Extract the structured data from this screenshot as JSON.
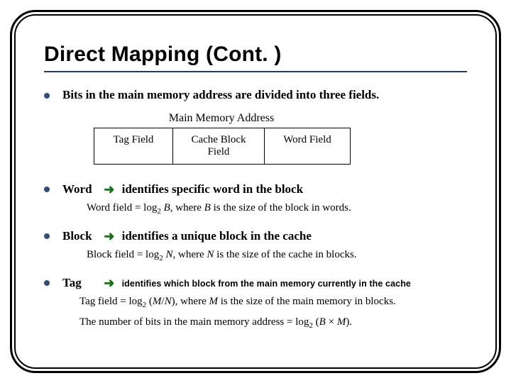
{
  "title": "Direct Mapping (Cont. )",
  "bullets": {
    "intro": "Bits in the main memory address are divided into three fields.",
    "word": {
      "term": "Word",
      "desc": "identifies specific word in the block"
    },
    "block": {
      "term": "Block",
      "desc": "identifies a unique block in the cache"
    },
    "tag": {
      "term": "Tag",
      "desc": "identifies which block from the main memory currently  in the cache"
    }
  },
  "diagram": {
    "caption": "Main Memory Address",
    "cells": {
      "tag": "Tag Field",
      "block": "Cache Block Field",
      "word": "Word Field"
    }
  },
  "formulas": {
    "word": {
      "lhs": "Word field",
      "rhs_a": "B",
      "tail": ", where ",
      "tail_var": "B",
      "tail2": " is the size of the block in words."
    },
    "block": {
      "lhs": "Block field",
      "rhs_a": "N",
      "tail": ", where ",
      "tail_var": "N",
      "tail2": " is the size of the cache in blocks."
    },
    "tag": {
      "lhs": "Tag field",
      "rhs_a": "(M/N)",
      "tail": ", where ",
      "tail_var": "M",
      "tail2": " is the size of the main memory in blocks."
    },
    "total": {
      "lhs": "The number of bits in the main memory address",
      "rhs_a": "(B × M)"
    }
  }
}
